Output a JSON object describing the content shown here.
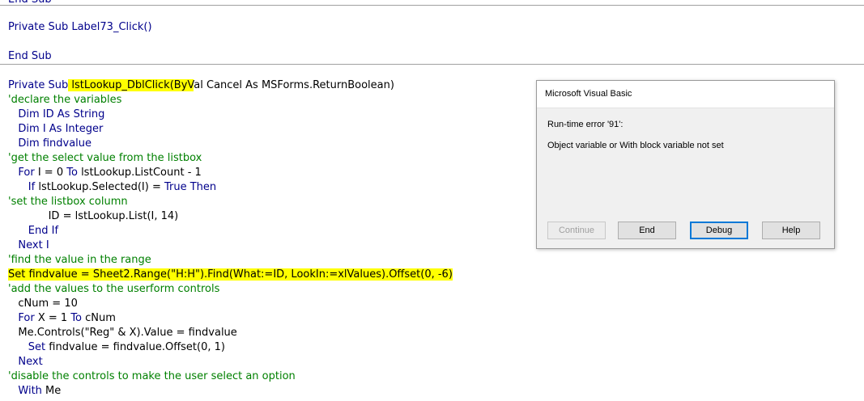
{
  "code_top_partial": "End Sub",
  "code": {
    "l1": "Private Sub Label73_Click()",
    "l2": "End Sub",
    "l3_kw": "Private Sub",
    "l3_hl": " lstLookup_DblClick(ByV",
    "l3_rest": "al Cancel As MSForms.ReturnBoolean)",
    "l4": "'declare the variables",
    "l5": "   Dim ID As String",
    "l6": "   Dim I As Integer",
    "l7": "   Dim findvalue",
    "l8": "'get the select value from the listbox",
    "l9_kw1": "   For ",
    "l9_mid": "I = 0 ",
    "l9_kw2": "To",
    "l9_rest": " lstLookup.ListCount - 1",
    "l10_kw1": "      If",
    "l10_mid": " lstLookup.Selected(I) = ",
    "l10_kw2": "True Then",
    "l11": "'set the listbox column",
    "l12": "            ID = lstLookup.List(I, 14)",
    "l13": "      End If",
    "l14": "   Next I",
    "l15": "'find the value in the range",
    "l16": "Set findvalue = Sheet2.Range(\"H:H\").Find(What:=ID, LookIn:=xlValues).Offset(0, -6)",
    "l17": "'add the values to the userform controls",
    "l18": "   cNum = 10",
    "l19_kw1": "   For ",
    "l19_mid": "X = 1 ",
    "l19_kw2": "To",
    "l19_rest": " cNum",
    "l20": "   Me.Controls(\"Reg\" & X).Value = findvalue",
    "l21_kw": "      Set",
    "l21_rest": " findvalue = findvalue.Offset(0, 1)",
    "l22": "   Next",
    "l23": "'disable the controls to make the user select an option",
    "l24_kw": "   With",
    "l24_rest": " Me"
  },
  "dialog": {
    "title": "Microsoft Visual Basic",
    "error": "Run-time error '91':",
    "message": "Object variable or With block variable not set",
    "buttons": {
      "continue": "Continue",
      "end": "End",
      "debug": "Debug",
      "help": "Help"
    }
  },
  "colors": {
    "keyword": "#00008b",
    "comment": "#008000",
    "highlight": "#ffff00"
  }
}
